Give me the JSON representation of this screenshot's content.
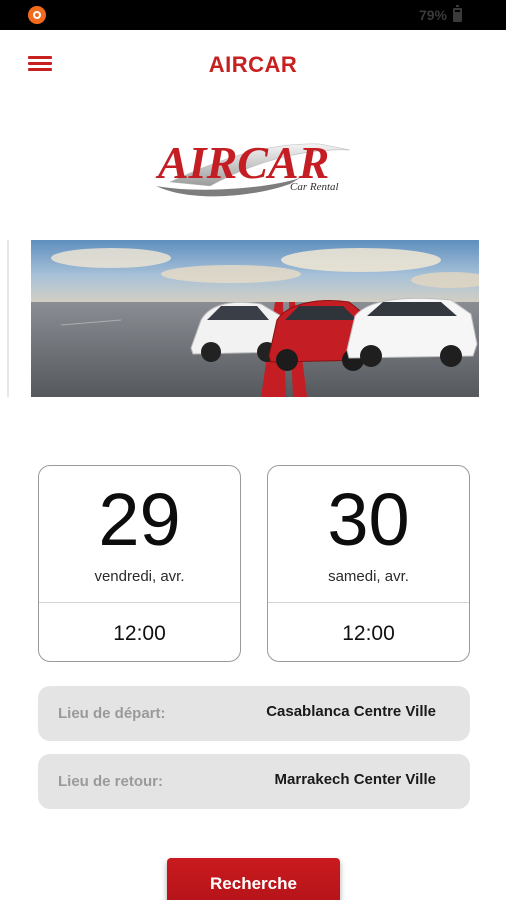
{
  "status_bar": {
    "battery_text": "79%",
    "app_icon": "orange-app-icon",
    "battery_icon": "battery-icon"
  },
  "app_bar": {
    "title": "AIRCAR",
    "menu_icon": "hamburger-menu-icon",
    "accent_color": "#c62020"
  },
  "logo": {
    "wordmark": "AIRCAR",
    "tagline": "Car Rental"
  },
  "banner": {
    "description_icon": "cars-on-road-banner"
  },
  "dates": {
    "start": {
      "day": "29",
      "sub": "vendredi, avr.",
      "time": "12:00"
    },
    "end": {
      "day": "30",
      "sub": "samedi, avr.",
      "time": "12:00"
    }
  },
  "locations": {
    "depart": {
      "label": "Lieu de départ:",
      "value": "Casablanca Centre Ville"
    },
    "retour": {
      "label": "Lieu de retour:",
      "value": "Marrakech Center Ville"
    }
  },
  "search_button": {
    "label": "Recherche"
  }
}
